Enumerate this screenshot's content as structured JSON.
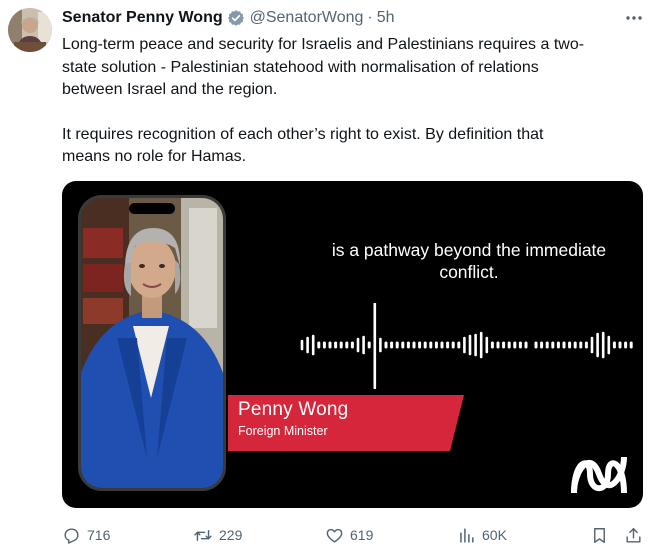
{
  "author": {
    "display_name": "Senator Penny Wong",
    "handle": "@SenatorWong",
    "separator": "·",
    "time_ago": "5h"
  },
  "tweet_text": {
    "paragraph_1": "Long-term peace and security for Israelis and Palestinians requires a two-\nstate solution - Palestinian statehood with normalisation of relations\nbetween Israel and the region.",
    "paragraph_2": "It requires recognition of each other’s right to exist. By definition that\nmeans no role for Hamas."
  },
  "video": {
    "caption": "is a pathway beyond the immediate\nconflict.",
    "speaker_name": "Penny Wong",
    "speaker_role": "Foreign Minister",
    "nameplate_color": "#d6263b",
    "logo": "abc-logo"
  },
  "metrics": {
    "replies": "716",
    "reposts": "229",
    "likes": "619",
    "views": "60K"
  },
  "icons": {
    "verified": "verified-badge-icon",
    "more": "more-options-icon",
    "reply": "reply-icon",
    "repost": "repost-icon",
    "like": "heart-icon",
    "views": "views-icon",
    "bookmark": "bookmark-icon",
    "share": "share-icon"
  },
  "colors": {
    "text_primary": "#0f1419",
    "text_secondary": "#536471",
    "verified_grey": "#829aab"
  }
}
